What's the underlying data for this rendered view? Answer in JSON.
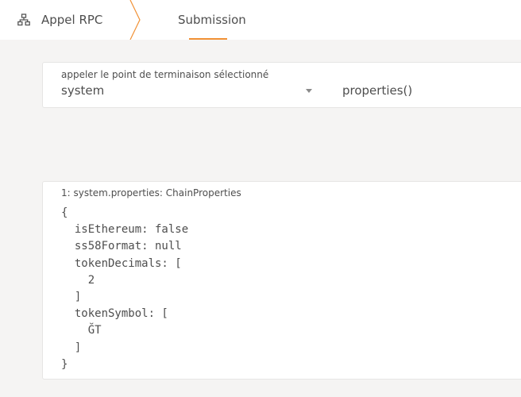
{
  "header": {
    "section_title": "Appel RPC",
    "section_icon": "network-icon",
    "tabs": [
      {
        "label": "Submission",
        "active": true
      }
    ]
  },
  "selector": {
    "label": "appeler le point de terminaison sélectionné",
    "section_value": "system",
    "method_value": "properties()"
  },
  "result": {
    "label": "1: system.properties: ChainProperties",
    "lines": [
      "{",
      "  isEthereum: false",
      "  ss58Format: null",
      "  tokenDecimals: [",
      "    2",
      "  ]",
      "  tokenSymbol: [",
      "    ĞT",
      "  ]",
      "}"
    ]
  },
  "colors": {
    "accent": "#f19135",
    "background": "#f5f4f3",
    "text": "#4e4e4e"
  }
}
